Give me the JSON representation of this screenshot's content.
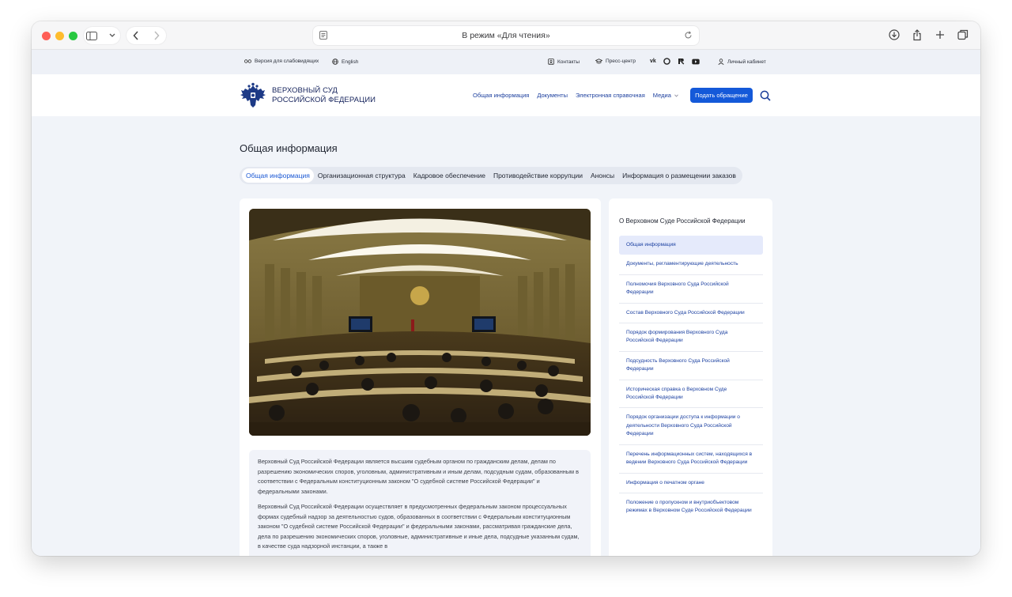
{
  "browser": {
    "address": "В режим «Для чтения»"
  },
  "topbar": {
    "accessibility": "Версия для слабовидящих",
    "language": "English",
    "contacts": "Контакты",
    "press": "Пресс-центр",
    "cabinet": "Личный кабинет",
    "social_icons": [
      "vk-icon",
      "ok-icon",
      "rutube-icon",
      "youtube-icon"
    ]
  },
  "header": {
    "logo_line1": "ВЕРХОВНЫЙ СУД",
    "logo_line2": "РОССИЙСКОЙ ФЕДЕРАЦИИ",
    "nav": [
      "Общая информация",
      "Документы",
      "Электронная справочная",
      "Медиа"
    ],
    "cta": "Подать обращение"
  },
  "page": {
    "title": "Общая информация",
    "tabs": [
      {
        "label": "Общая информация",
        "active": true
      },
      {
        "label": "Организационная структура",
        "active": false
      },
      {
        "label": "Кадровое обеспечение",
        "active": false
      },
      {
        "label": "Противодействие коррупции",
        "active": false
      },
      {
        "label": "Анонсы",
        "active": false
      },
      {
        "label": "Информация о размещении заказов",
        "active": false
      }
    ]
  },
  "content": {
    "paragraph1": "Верховный Суд Российской Федерации является высшим судебным органом по гражданским делам, делам по разрешению экономических споров, уголовным, административным и иным делам, подсудным судам, образованным в соответствии с Федеральным конституционным законом \"О судебной системе Российской Федерации\" и федеральными законами.",
    "paragraph2": "Верховный Суд Российской Федерации осуществляет в предусмотренных федеральным законом процессуальных формах судебный надзор за деятельностью судов, образованных в соответствии с Федеральным конституционным законом \"О судебной системе Российской Федерации\" и федеральными законами, рассматривая гражданские дела, дела по разрешению экономических споров, уголовные, административные и иные дела, подсудные указанным судам, в качестве суда надзорной инстанции, а также в"
  },
  "sidebar": {
    "title": "О Верховном Суде Российской Федерации",
    "items": [
      {
        "label": "Общая информация",
        "active": true
      },
      {
        "label": "Документы, регламентирующие деятельность",
        "active": false
      },
      {
        "label": "Полномочия Верховного Суда Российской Федерации",
        "active": false
      },
      {
        "label": "Состав Верховного Суда Российской Федерации",
        "active": false
      },
      {
        "label": "Порядок формирования Верховного Суда Российской Федерации",
        "active": false
      },
      {
        "label": "Подсудность Верховного Суда Российской Федерации",
        "active": false
      },
      {
        "label": "Историческая справка о Верховном Суде Российской Федерации",
        "active": false
      },
      {
        "label": "Порядок организации доступа к информации о деятельности Верховного Суда Российской Федерации",
        "active": false
      },
      {
        "label": "Перечень информационных систем, находящихся в ведении Верховного Суда Российской Федерации",
        "active": false
      },
      {
        "label": "Информация о печатном органе",
        "active": false
      },
      {
        "label": "Положение о пропускном и внутриобъектовом режимах в Верховном Суде Российской Федерации",
        "active": false
      }
    ]
  },
  "colors": {
    "accent": "#1459d9",
    "link": "#1a3fa0",
    "background": "#f1f4f9"
  }
}
